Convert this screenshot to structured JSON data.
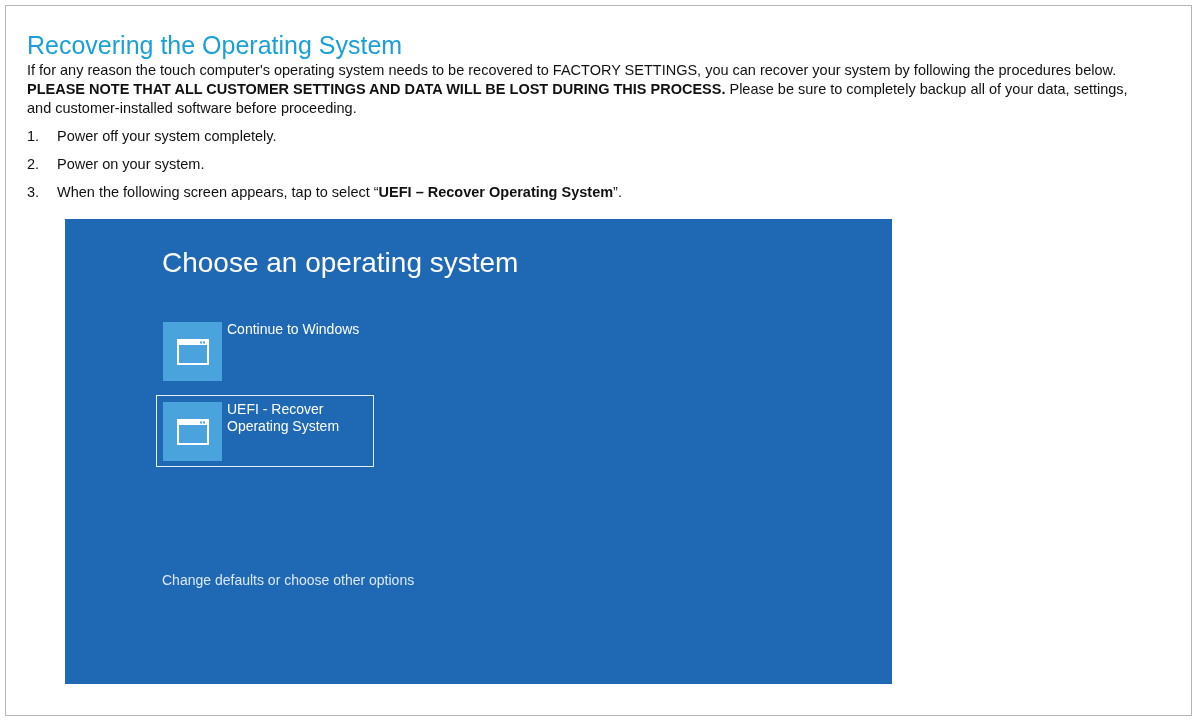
{
  "title": "Recovering the Operating System",
  "intro": "If for any reason the touch computer's operating system needs to be recovered to FACTORY SETTINGS, you can recover your system by following the procedures below. **PLEASE NOTE THAT ALL CUSTOMER SETTINGS AND DATA WILL BE LOST DURING THIS PROCESS.** Please be sure to completely backup all of your data, settings, and customer-installed software before proceeding.",
  "steps": [
    {
      "number": "1.",
      "text": "Power off your system completely."
    },
    {
      "number": "2.",
      "text": "Power on your system."
    },
    {
      "number": "3.",
      "text": "When the following screen appears, tap to select “**UEFI – Recover Operating System**”."
    }
  ],
  "boot_screen": {
    "heading": "Choose an operating system",
    "options": [
      {
        "label": "Continue to Windows",
        "selected": false
      },
      {
        "label": "UEFI - Recover Operating System",
        "selected": true
      }
    ],
    "footer_link": "Change defaults or choose other options"
  }
}
